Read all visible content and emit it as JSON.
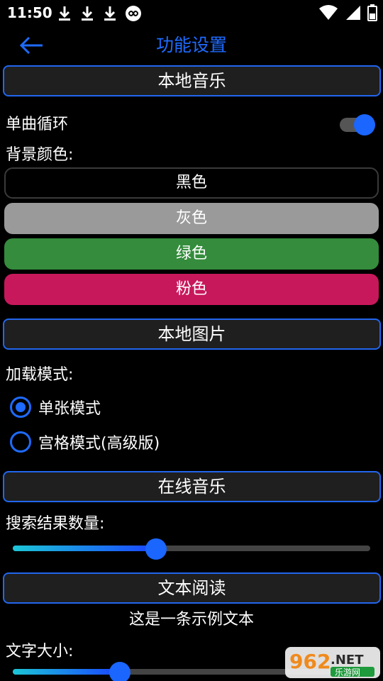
{
  "status_bar": {
    "time": "11:50",
    "left_icons": [
      "download-icon",
      "download-icon",
      "download-icon",
      "infinity-icon"
    ],
    "right_icons": [
      "wifi-icon",
      "signal-icon",
      "battery-icon"
    ]
  },
  "app_bar": {
    "back_icon": "arrow-left-icon",
    "title": "功能设置",
    "accent_color": "#1e6bff"
  },
  "local_music": {
    "header": "本地音乐",
    "single_loop_label": "单曲循环",
    "single_loop_on": true,
    "bg_color_label": "背景颜色:",
    "color_buttons": [
      {
        "label": "黑色",
        "color": "#000000"
      },
      {
        "label": "灰色",
        "color": "#9a9a9a"
      },
      {
        "label": "绿色",
        "color": "#348c3c"
      },
      {
        "label": "粉色",
        "color": "#c8185c"
      }
    ]
  },
  "local_images": {
    "header": "本地图片",
    "load_mode_label": "加载模式:",
    "options": [
      {
        "label": "单张模式",
        "checked": true
      },
      {
        "label": "宫格模式(高级版)",
        "checked": false
      }
    ]
  },
  "online_music": {
    "header": "在线音乐",
    "result_count_label": "搜索结果数量:",
    "result_count_fraction": 0.4
  },
  "text_reading": {
    "header": "文本阅读",
    "sample_text": "这是一条示例文本",
    "font_size_label": "文字大小:",
    "font_size_fraction": 0.3
  },
  "watermark": {
    "number": "962",
    "suffix": ".NET",
    "caption": "乐游网"
  }
}
